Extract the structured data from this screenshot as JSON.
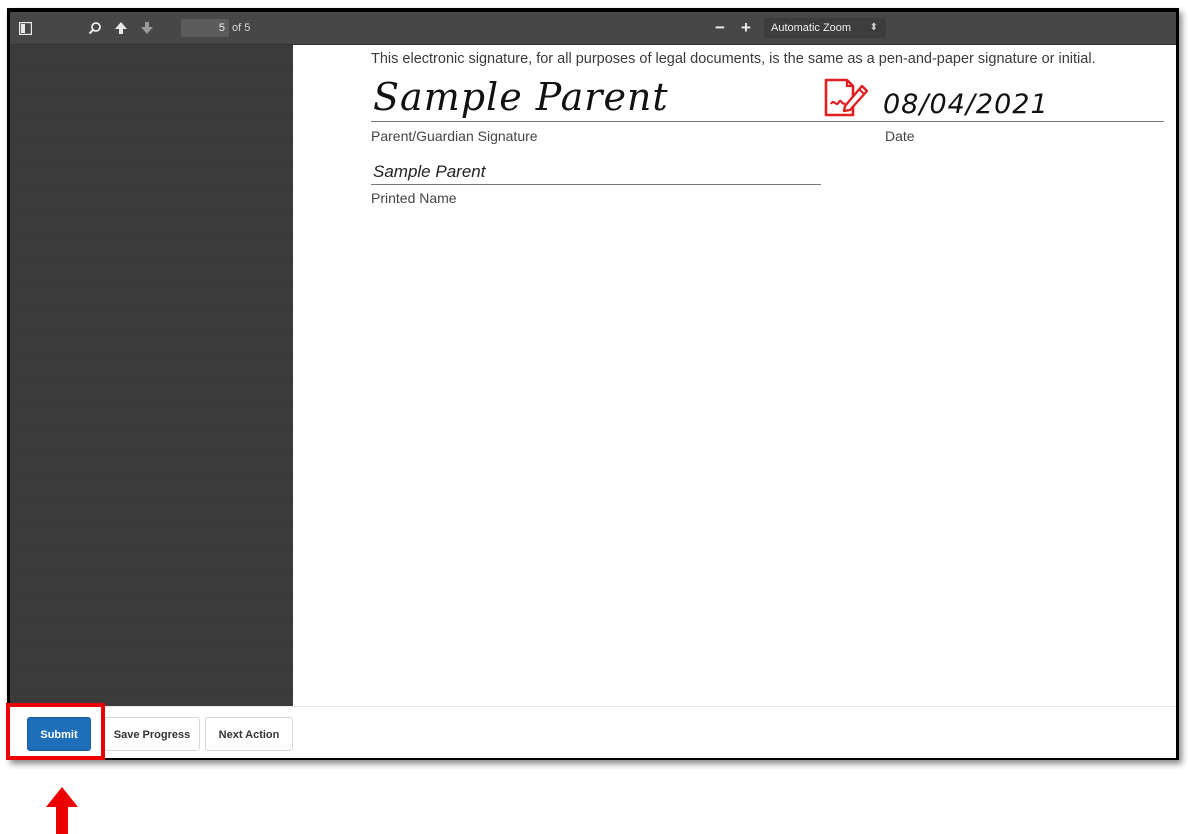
{
  "toolbar": {
    "page_current": "5",
    "page_of": "of 5",
    "zoom_out": "−",
    "zoom_in": "+",
    "zoom_select": "Automatic Zoom"
  },
  "document": {
    "intro_text": "This electronic signature, for all purposes of legal documents, is the same as a pen-and-paper signature or initial.",
    "signature_value": "Sample Parent",
    "signature_label": "Parent/Guardian Signature",
    "date_value": "08/04/2021",
    "date_label": "Date",
    "printed_name_value": "Sample Parent",
    "printed_name_label": "Printed Name"
  },
  "actions": {
    "submit": "Submit",
    "save_progress": "Save Progress",
    "next_action": "Next Action"
  },
  "colors": {
    "primary_button": "#1e6eb8",
    "highlight": "#ee0000",
    "toolbar": "#474747",
    "sidebar": "#3a3a3a"
  },
  "icons": [
    "sidebar-toggle-icon",
    "search-icon",
    "arrow-up-icon",
    "arrow-down-icon",
    "signature-pen-icon",
    "red-arrow-annotation"
  ]
}
